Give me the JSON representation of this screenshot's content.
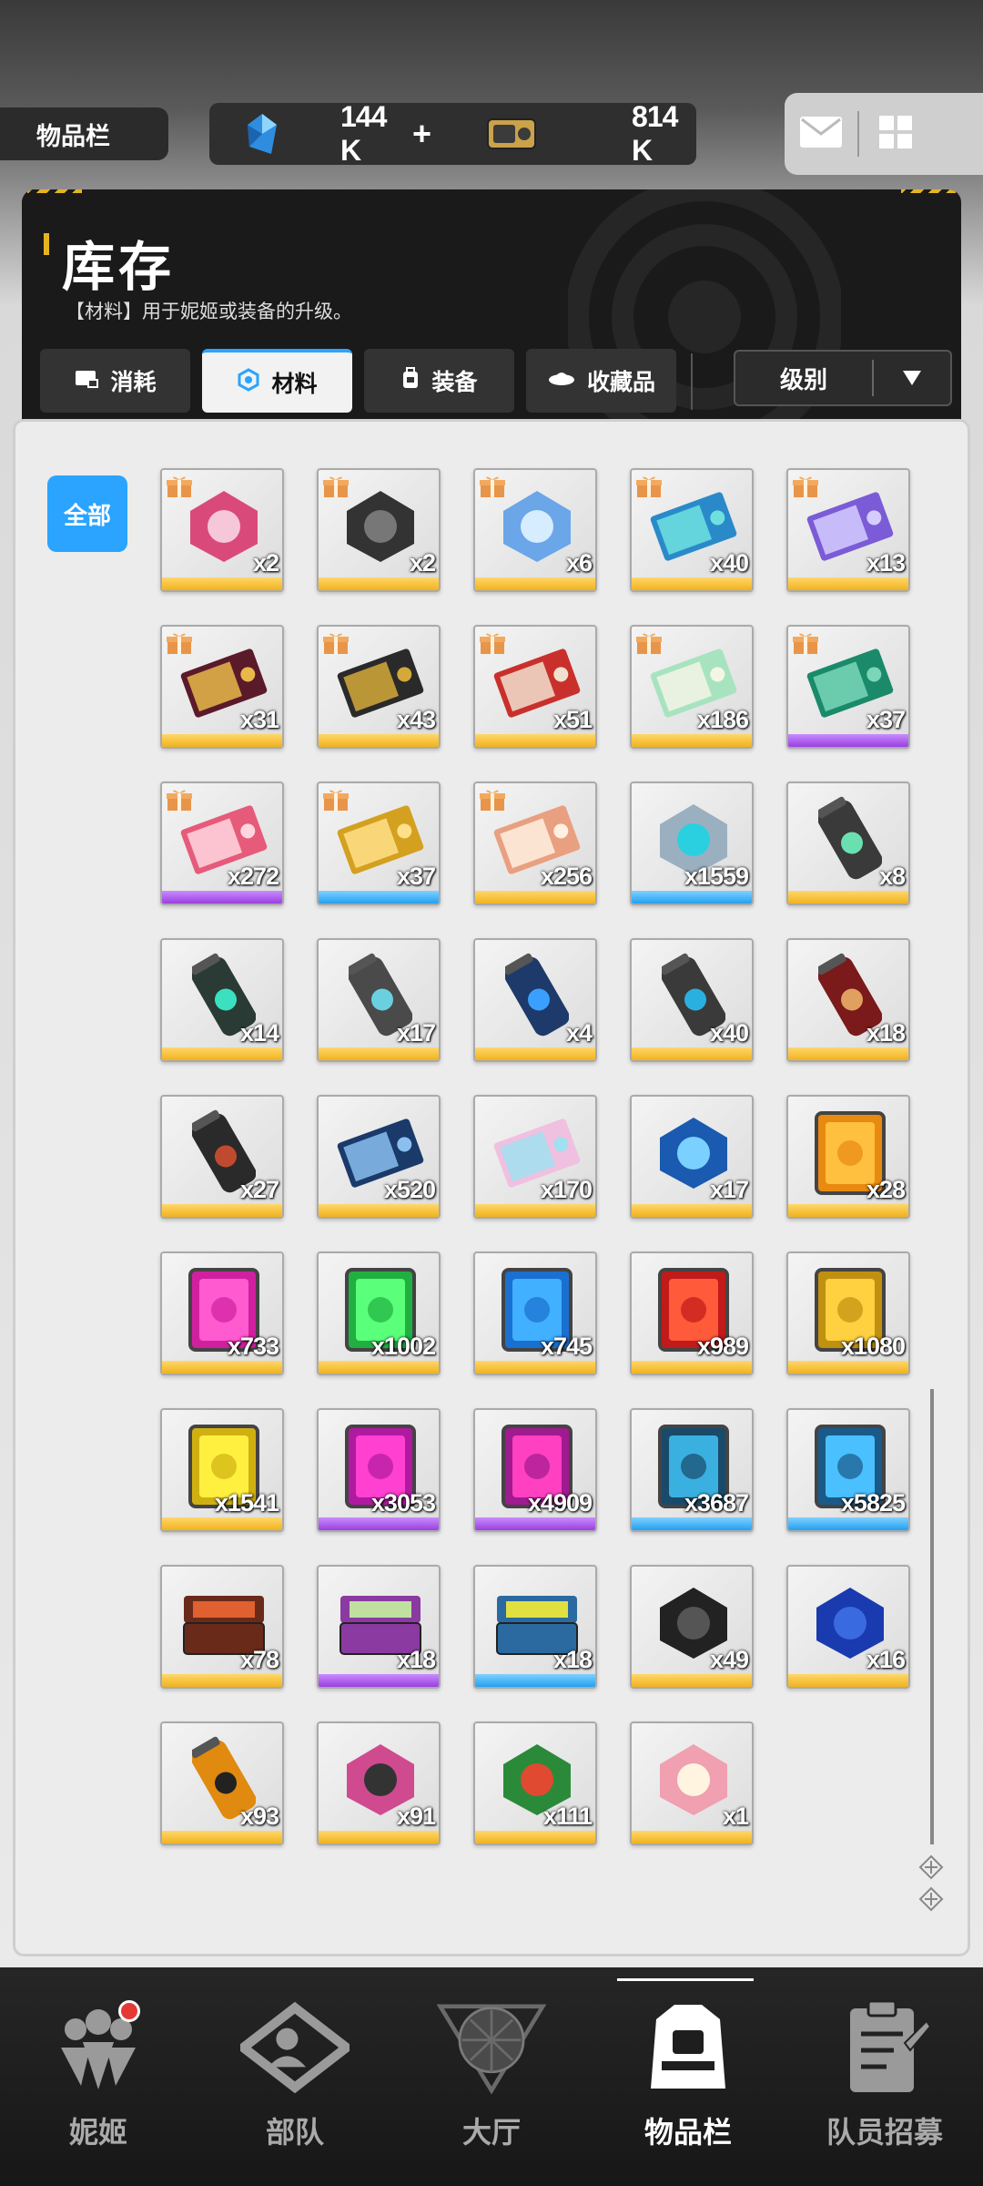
{
  "topbar": {
    "breadcrumb": "物品栏",
    "gems": "144 K",
    "gems_plus": "+",
    "credits": "814 K"
  },
  "header": {
    "title": "库存",
    "description": "【材料】用于妮姬或装备的升级。",
    "tabs": [
      {
        "label": "消耗",
        "icon": "consumable-icon"
      },
      {
        "label": "材料",
        "icon": "material-hex-icon"
      },
      {
        "label": "装备",
        "icon": "equipment-icon"
      },
      {
        "label": "收藏品",
        "icon": "collectible-icon"
      }
    ],
    "active_tab": "材料",
    "sort_label": "级别"
  },
  "filter": {
    "all_label": "全部"
  },
  "items": [
    {
      "count": "x2",
      "rarity": "gold",
      "gift": true,
      "icon": "gift-pack-icon"
    },
    {
      "count": "x2",
      "rarity": "gold",
      "gift": true,
      "icon": "walkie-talkie-icon"
    },
    {
      "count": "x6",
      "rarity": "gold",
      "gift": true,
      "icon": "water-bottles-icon"
    },
    {
      "count": "x40",
      "rarity": "gold",
      "gift": true,
      "icon": "blue-ticket-icon"
    },
    {
      "count": "x13",
      "rarity": "gold",
      "gift": true,
      "icon": "purple-ticket-icon"
    },
    {
      "count": "x31",
      "rarity": "gold",
      "gift": true,
      "icon": "vip-card-icon"
    },
    {
      "count": "x43",
      "rarity": "gold",
      "gift": true,
      "icon": "gold-vip-card-icon"
    },
    {
      "count": "x51",
      "rarity": "gold",
      "gift": true,
      "icon": "red-ticket-icon"
    },
    {
      "count": "x186",
      "rarity": "gold",
      "gift": true,
      "icon": "green-ticket-icon"
    },
    {
      "count": "x37",
      "rarity": "purple",
      "gift": true,
      "icon": "week-ticket-icon"
    },
    {
      "count": "x272",
      "rarity": "purple",
      "gift": true,
      "icon": "pink-ticket-icon"
    },
    {
      "count": "x37",
      "rarity": "blue",
      "gift": true,
      "icon": "day-ticket-icon"
    },
    {
      "count": "x256",
      "rarity": "gold",
      "gift": true,
      "icon": "cake-ticket-icon"
    },
    {
      "count": "x1559",
      "rarity": "blue",
      "gift": false,
      "icon": "hex-core-icon"
    },
    {
      "count": "x8",
      "rarity": "gold",
      "gift": false,
      "icon": "green-canister-icon"
    },
    {
      "count": "x14",
      "rarity": "gold",
      "gift": false,
      "icon": "teal-battery-icon"
    },
    {
      "count": "x17",
      "rarity": "gold",
      "gift": false,
      "icon": "grey-battery-icon"
    },
    {
      "count": "x4",
      "rarity": "gold",
      "gift": false,
      "icon": "blue-battery-icon"
    },
    {
      "count": "x40",
      "rarity": "gold",
      "gift": false,
      "icon": "dark-battery-icon"
    },
    {
      "count": "x18",
      "rarity": "gold",
      "gift": false,
      "icon": "red-battery-icon"
    },
    {
      "count": "x27",
      "rarity": "gold",
      "gift": false,
      "icon": "black-battery-icon"
    },
    {
      "count": "x520",
      "rarity": "gold",
      "gift": false,
      "icon": "infinity-card-icon"
    },
    {
      "count": "x170",
      "rarity": "gold",
      "gift": false,
      "icon": "holo-ticket-icon"
    },
    {
      "count": "x17",
      "rarity": "gold",
      "gift": false,
      "icon": "blue-crystal-icon"
    },
    {
      "count": "x28",
      "rarity": "gold",
      "gift": false,
      "icon": "orange-module-icon"
    },
    {
      "count": "x733",
      "rarity": "gold",
      "gift": false,
      "icon": "electric-module-icon"
    },
    {
      "count": "x1002",
      "rarity": "gold",
      "gift": false,
      "icon": "wind-module-icon"
    },
    {
      "count": "x745",
      "rarity": "gold",
      "gift": false,
      "icon": "water-module-icon"
    },
    {
      "count": "x989",
      "rarity": "gold",
      "gift": false,
      "icon": "fire-module-icon"
    },
    {
      "count": "x1080",
      "rarity": "gold",
      "gift": false,
      "icon": "iron-module-icon"
    },
    {
      "count": "x1541",
      "rarity": "gold",
      "gift": false,
      "icon": "yellow-module-icon"
    },
    {
      "count": "x3053",
      "rarity": "purple",
      "gift": false,
      "icon": "magenta-module-icon"
    },
    {
      "count": "x4909",
      "rarity": "purple",
      "gift": false,
      "icon": "violet-module-icon"
    },
    {
      "count": "x3687",
      "rarity": "blue",
      "gift": false,
      "icon": "cyan-module-icon"
    },
    {
      "count": "x5825",
      "rarity": "blue",
      "gift": false,
      "icon": "arrow-module-icon"
    },
    {
      "count": "x78",
      "rarity": "gold",
      "gift": false,
      "icon": "red-toolbox-icon"
    },
    {
      "count": "x18",
      "rarity": "purple",
      "gift": false,
      "icon": "purple-toolbox-icon"
    },
    {
      "count": "x18",
      "rarity": "blue",
      "gift": false,
      "icon": "blue-toolbox-icon"
    },
    {
      "count": "x49",
      "rarity": "gold",
      "gift": false,
      "icon": "charger-icon"
    },
    {
      "count": "x16",
      "rarity": "gold",
      "gift": false,
      "icon": "blue-cloth-icon"
    },
    {
      "count": "x93",
      "rarity": "gold",
      "gift": false,
      "icon": "battery-cell-icon"
    },
    {
      "count": "x91",
      "rarity": "gold",
      "gift": false,
      "icon": "polisher-icon"
    },
    {
      "count": "x111",
      "rarity": "gold",
      "gift": false,
      "icon": "toy-train-icon"
    },
    {
      "count": "x1",
      "rarity": "gold",
      "gift": false,
      "icon": "cake-icon"
    }
  ],
  "bottom_nav": [
    {
      "label": "妮姬",
      "icon": "nikke-icon",
      "active": false,
      "badge": true
    },
    {
      "label": "部队",
      "icon": "squad-icon",
      "active": false,
      "badge": false
    },
    {
      "label": "大厅",
      "icon": "lobby-icon",
      "active": false,
      "badge": false
    },
    {
      "label": "物品栏",
      "icon": "inventory-icon",
      "active": true,
      "badge": false
    },
    {
      "label": "队员招募",
      "icon": "recruit-icon",
      "active": false,
      "badge": false
    }
  ],
  "colors": {
    "accent": "#2aa4ff",
    "gold": "#f0b21e",
    "purple": "#9a3fe0",
    "blue": "#24a0f0",
    "badge": "#e53935"
  }
}
